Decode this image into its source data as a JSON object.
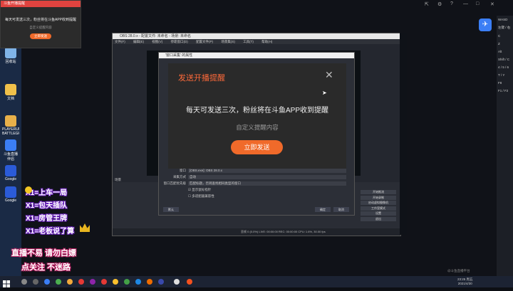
{
  "notification": {
    "title": "斗鱼开播提醒",
    "message": "每天可发送三次，粉丝将在斗鱼APP收到提醒",
    "placeholder": "自定义提醒内容",
    "send_button": "立即发送"
  },
  "obs": {
    "title": "OBS 28.0.x - 配置文件: 未命名 - 场景: 未命名",
    "menu": [
      "文件(F)",
      "编辑(E)",
      "视图(V)",
      "停靠窗口(D)",
      "配置文件(P)",
      "场景集(S)",
      "工具(T)",
      "帮助(H)"
    ],
    "docks": {
      "scenes": "场景",
      "sources": "来源",
      "mixer": "音频混音器"
    },
    "controls": [
      "开始推流",
      "开始录制",
      "启动虚拟摄像机",
      "工作室模式",
      "设置",
      "退出"
    ],
    "status": "丢帧 0 (0.0%)   LIVE: 00:00:00   REC: 00:00:00   CPU: 1.6%, 30.00 fps"
  },
  "properties_dialog": {
    "title": "'窗口采集' 的属性",
    "fields": [
      {
        "label": "窗口",
        "value": "[OBS.exe]: OBS 28.0.x"
      },
      {
        "label": "采集方式",
        "value": "自动"
      },
      {
        "label": "窗口匹配优先级",
        "value": "匹配标题，否则查找相同类型的窗口"
      }
    ],
    "checkboxes": [
      "显示鼠标指针",
      "多适配器兼容性"
    ],
    "defaults_button": "默认",
    "ok_button": "确定",
    "cancel_button": "取消"
  },
  "modal": {
    "title": "发送开播提醒",
    "message": "每天可发送三次，粉丝将在斗鱼APP收到提醒",
    "placeholder": "自定义提醒内容",
    "send_button": "立即发送"
  },
  "overlay": {
    "lines": [
      "X1=上车一局",
      "X1=包天插队",
      "X1=房管王牌",
      "X1=老板说了算"
    ],
    "slogan1": "直播不易  请勿白嫖",
    "slogan2": "点关注  不迷路"
  },
  "desktop_icons": [
    "回收站",
    "文档",
    "PLAYERUNKNOWN'S BATTLEGROUNDS",
    "斗鱼直播伴侣",
    "Google",
    "Google"
  ],
  "right_panel": [
    "WASD",
    "左键 / 右",
    "C",
    "Z",
    "Alt",
    "Shift / C",
    "4 / 5 / 6",
    "T / Y",
    "F8",
    "F1 / F2"
  ],
  "clock": {
    "time": "23:25 周五",
    "date": "2021/4/30"
  },
  "watermark": "@斗鱼直播平台"
}
